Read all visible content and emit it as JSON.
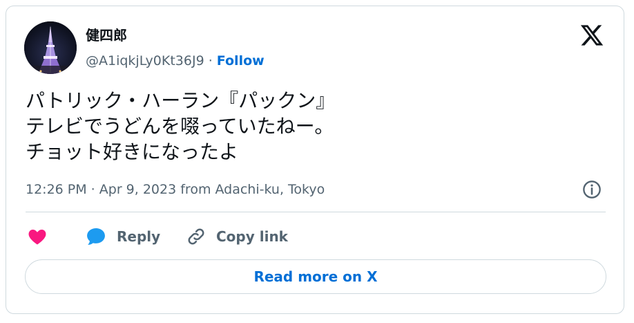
{
  "colors": {
    "accent": "#006fd6",
    "like": "#f91880",
    "reply": "#1d9bf0",
    "muted": "#536471",
    "text": "#0f1419",
    "border": "#cfd9de"
  },
  "author": {
    "display_name": "健四郎",
    "handle": "@A1iqkjLy0Kt36J9",
    "separator": " · ",
    "follow_label": "Follow",
    "avatar_icon": "tokyo-tower-night-photo"
  },
  "tweet": {
    "lines": [
      "パトリック・ハーラン『パックン』",
      "テレビでうどんを啜っていたねー。",
      "チョット好きになったよ"
    ],
    "timestamp": "12:26 PM · Apr 9, 2023 from Adachi-ku, Tokyo"
  },
  "actions": {
    "like_icon": "heart-icon",
    "reply_icon": "speech-bubble-icon",
    "reply_label": "Reply",
    "copy_icon": "link-icon",
    "copy_label": "Copy link"
  },
  "read_more_label": "Read more on X",
  "logo": "x-logo",
  "info_icon": "info-icon"
}
